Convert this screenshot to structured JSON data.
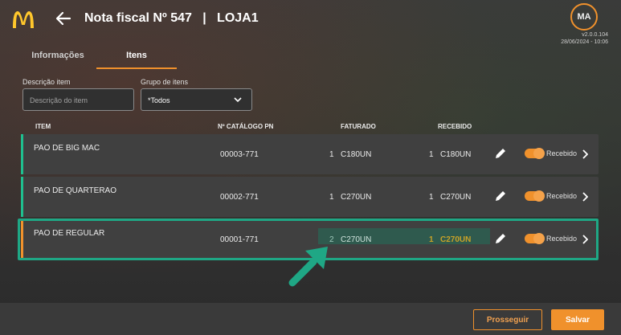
{
  "header": {
    "title": "Nota fiscal Nº 547   |   LOJA1",
    "avatar_initials": "MA",
    "version": "v2.0.0.104",
    "datetime": "28/06/2024 - 10:06",
    "logo_icon": "mcdonalds-logo",
    "back_icon": "arrow-left-icon"
  },
  "tabs": [
    {
      "label": "Informações",
      "active": false
    },
    {
      "label": "Itens",
      "active": true
    }
  ],
  "filters": {
    "description_label": "Descrição item",
    "description_placeholder": "Descrição do item",
    "group_label": "Grupo de itens",
    "group_value": "*Todos"
  },
  "table": {
    "headers": {
      "item": "ITEM",
      "catalog": "Nº CATÁLOGO PN",
      "billed": "FATURADO",
      "received": "RECEBIDO"
    },
    "rows": [
      {
        "name": "PAO DE BIG MAC",
        "catalog": "00003-771",
        "billed_qty": "1",
        "billed_unit": "C180UN",
        "received_qty": "1",
        "received_unit": "C180UN",
        "status": "Recebido",
        "status_color": "#1fbf8f"
      },
      {
        "name": "PAO DE QUARTERAO",
        "catalog": "00002-771",
        "billed_qty": "1",
        "billed_unit": "C270UN",
        "received_qty": "1",
        "received_unit": "C270UN",
        "status": "Recebido",
        "status_color": "#1fbf8f"
      },
      {
        "name": "PAO DE REGULAR",
        "catalog": "00001-771",
        "billed_qty": "2",
        "billed_unit": "C270UN",
        "received_qty": "1",
        "received_unit": "C270UN",
        "status": "Recebido",
        "status_color": "#f0912c"
      }
    ]
  },
  "footer": {
    "secondary_label": "Prosseguir",
    "primary_label": "Salvar"
  },
  "colors": {
    "accent": "#f0912c",
    "highlight": "#1fa785",
    "ok_bar": "#1fbf8f",
    "mismatch_text": "#c9a227"
  }
}
